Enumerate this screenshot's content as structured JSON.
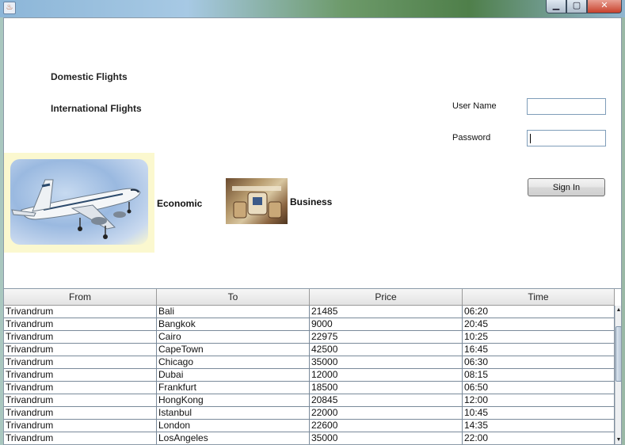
{
  "window": {
    "icons": {
      "app": "java-cup-icon",
      "minimize": "minimize-icon",
      "maximize": "maximize-icon",
      "close": "close-icon"
    },
    "minimize_glyph": "▁",
    "maximize_glyph": "▢",
    "close_glyph": "✕",
    "app_glyph": "♨"
  },
  "nav": {
    "domestic": "Domestic Flights",
    "international": "International Flights"
  },
  "login": {
    "username_label": "User Name",
    "password_label": "Password",
    "username_value": "",
    "password_value": "",
    "sign_in_label": "Sign In"
  },
  "categories": {
    "economic": "Economic",
    "business": "Business"
  },
  "table": {
    "headers": [
      "From",
      "To",
      "Price",
      "Time"
    ],
    "rows": [
      [
        "Trivandrum",
        "Bali",
        "21485",
        "06:20"
      ],
      [
        "Trivandrum",
        "Bangkok",
        "9000",
        "20:45"
      ],
      [
        "Trivandrum",
        "Cairo",
        "22975",
        "10:25"
      ],
      [
        "Trivandrum",
        "CapeTown",
        "42500",
        "16:45"
      ],
      [
        "Trivandrum",
        "Chicago",
        "35000",
        "06:30"
      ],
      [
        "Trivandrum",
        "Dubai",
        "12000",
        "08:15"
      ],
      [
        "Trivandrum",
        "Frankfurt",
        "18500",
        "06:50"
      ],
      [
        "Trivandrum",
        "HongKong",
        "20845",
        "12:00"
      ],
      [
        "Trivandrum",
        "Istanbul",
        "22000",
        "10:45"
      ],
      [
        "Trivandrum",
        "London",
        "22600",
        "14:35"
      ],
      [
        "Trivandrum",
        "LosAngeles",
        "35000",
        "22:00"
      ]
    ]
  },
  "colors": {
    "content_bg": "#ffffff",
    "grid_line": "#7a8a9a",
    "plane_bg": "#fbf8cf"
  }
}
